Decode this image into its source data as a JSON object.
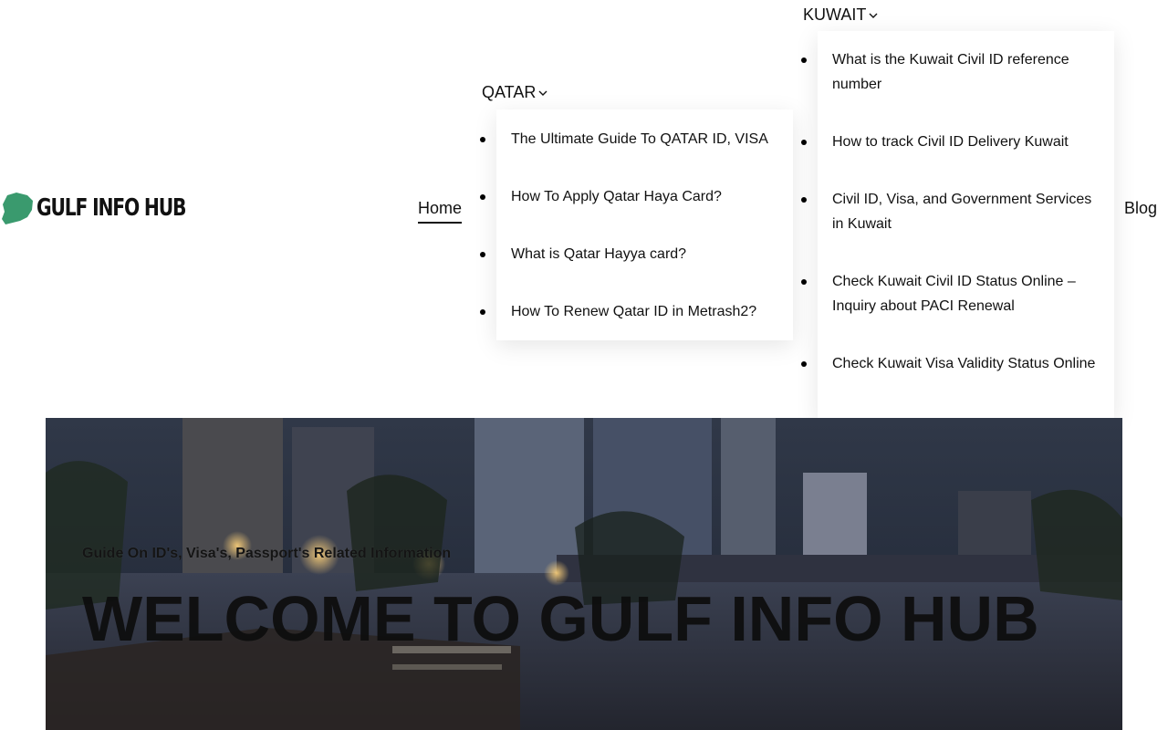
{
  "brand": {
    "name": "GULF INFO HUB",
    "accent": "#3a9a6e"
  },
  "nav": {
    "home": "Home",
    "qatar": {
      "label": "QATAR",
      "items": [
        "The Ultimate Guide To QATAR ID, VISA",
        "How To Apply Qatar Haya Card?",
        "What is Qatar Hayya card?",
        "How To Renew Qatar ID in Metrash2?"
      ]
    },
    "kuwait": {
      "label": "KUWAIT",
      "items": [
        "What is the Kuwait Civil ID reference number",
        "How to track Civil ID Delivery Kuwait",
        "Civil ID, Visa, and Government Services in Kuwait",
        "Check Kuwait Civil ID Status Online – Inquiry about PACI Renewal",
        "Check Kuwait Visa Validity Status Online"
      ]
    },
    "blog": "Blog"
  },
  "hero": {
    "subtitle": "Guide On ID's, Visa's, Passport's Related Information",
    "title": "WELCOME TO GULF INFO HUB"
  }
}
